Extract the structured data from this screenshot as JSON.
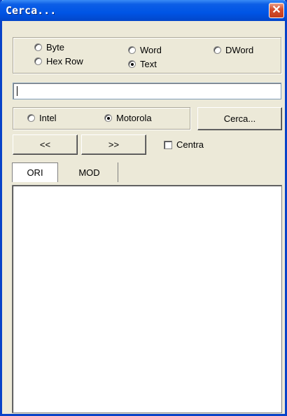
{
  "window": {
    "title": "Cerca...",
    "close_glyph": "✕"
  },
  "type_options": [
    {
      "label": "Byte",
      "selected": false
    },
    {
      "label": "Word",
      "selected": false
    },
    {
      "label": "DWord",
      "selected": false
    },
    {
      "label": "Hex Row",
      "selected": false
    },
    {
      "label": "Text",
      "selected": true
    }
  ],
  "search_field": {
    "value": ""
  },
  "byte_order": [
    {
      "label": "Intel",
      "selected": false
    },
    {
      "label": "Motorola",
      "selected": true
    }
  ],
  "buttons": {
    "search": "Cerca...",
    "prev": "<<",
    "next": ">>"
  },
  "centra": {
    "label": "Centra",
    "checked": false
  },
  "tabs": [
    {
      "label": "ORI",
      "active": true
    },
    {
      "label": "MOD",
      "active": false
    }
  ],
  "colors": {
    "titlebar": "#0055e5",
    "face": "#ece9d8",
    "close": "#d6502f"
  },
  "icons": {
    "close": "close-icon"
  }
}
